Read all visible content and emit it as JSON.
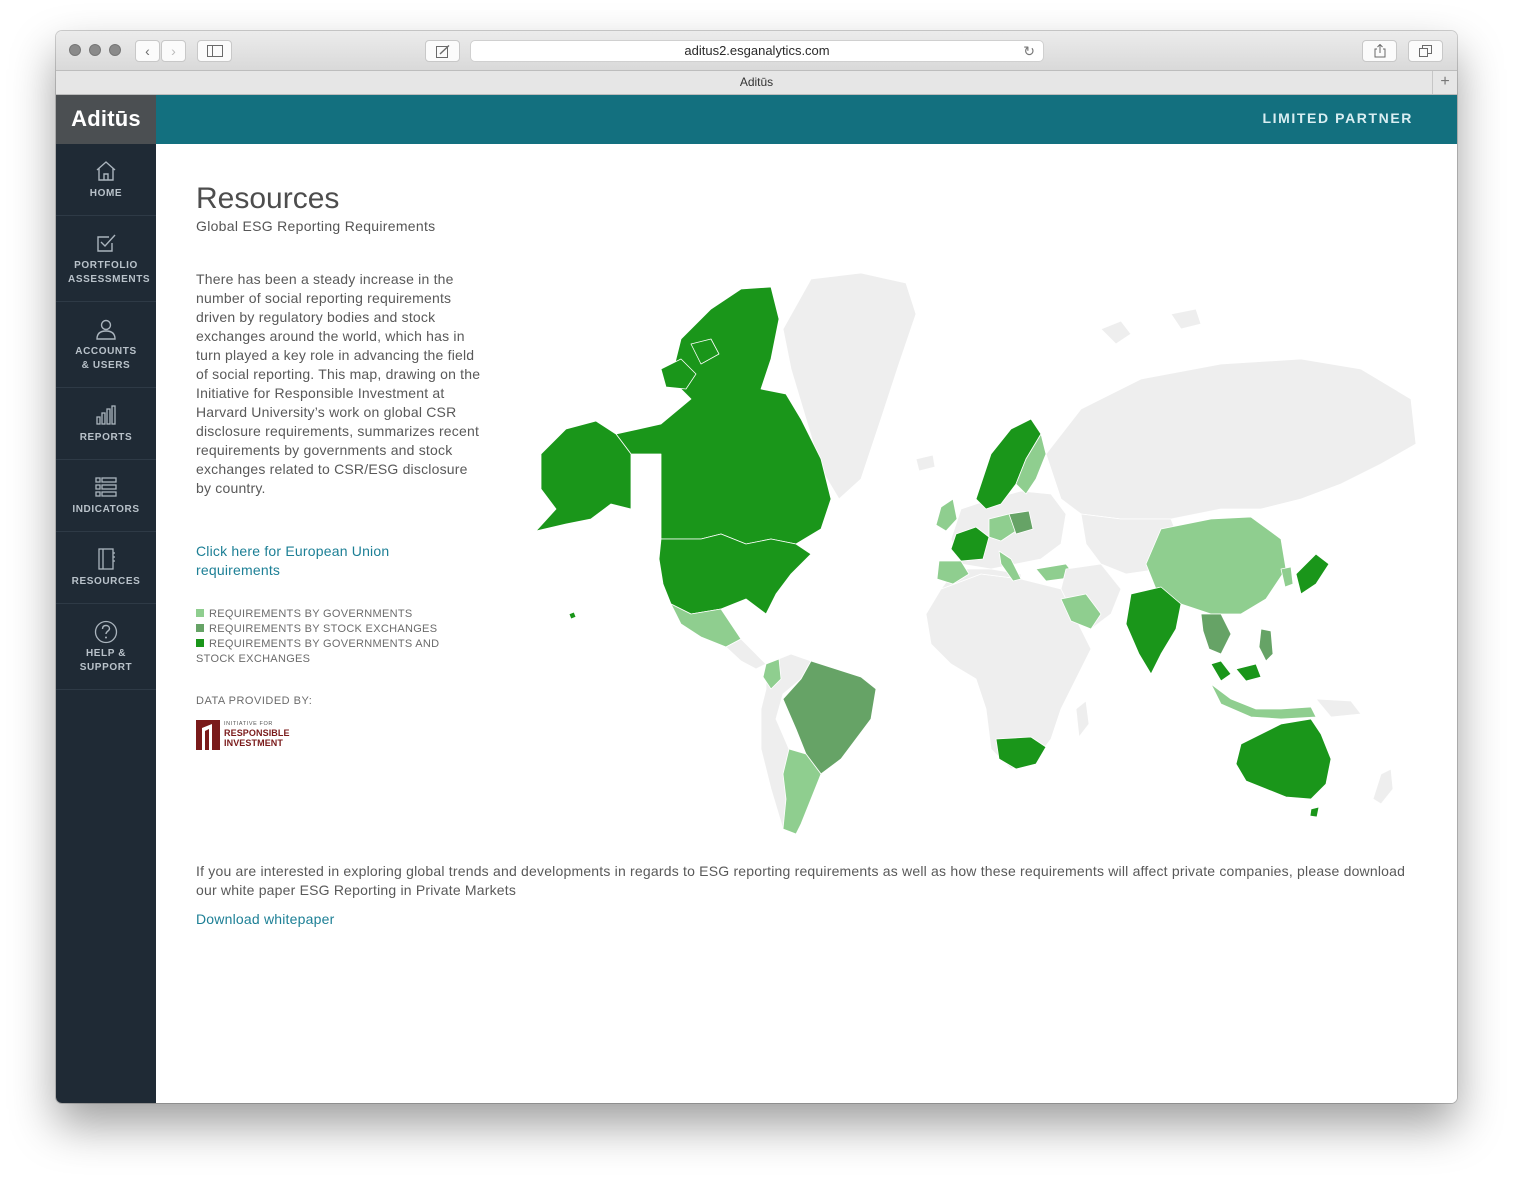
{
  "browser": {
    "url": "aditus2.esganalytics.com",
    "tab_title": "Aditūs"
  },
  "app": {
    "logo": "Aditūs",
    "role": "LIMITED PARTNER"
  },
  "sidebar": {
    "items": [
      {
        "label": "HOME",
        "icon": "home-icon"
      },
      {
        "label": "PORTFOLIO ASSESSMENTS",
        "icon": "checkbox-icon"
      },
      {
        "label": "ACCOUNTS & USERS",
        "icon": "user-icon"
      },
      {
        "label": "REPORTS",
        "icon": "bar-chart-icon"
      },
      {
        "label": "INDICATORS",
        "icon": "list-icon"
      },
      {
        "label": "RESOURCES",
        "icon": "notebook-icon"
      },
      {
        "label": "HELP & SUPPORT",
        "icon": "question-icon"
      }
    ]
  },
  "page": {
    "title": "Resources",
    "subtitle": "Global ESG Reporting Requirements",
    "intro": "There has been a steady increase in the number of social reporting requirements driven by regulatory bodies and stock exchanges around the world, which has in turn played a key role in advancing the field of social reporting. This map, drawing on the Initiative for Responsible Investment at Harvard University’s work on global CSR disclosure requirements, summarizes recent requirements by governments and stock exchanges related to CSR/ESG disclosure by country.",
    "eu_link": "Click here for European Union requirements",
    "legend": [
      {
        "label": "REQUIREMENTS BY GOVERNMENTS",
        "color": "#8fce8f"
      },
      {
        "label": "REQUIREMENTS BY STOCK EXCHANGES",
        "color": "#66a366"
      },
      {
        "label": "REQUIREMENTS BY GOVERNMENTS AND STOCK EXCHANGES",
        "color": "#1a961a"
      }
    ],
    "data_provided_by": "DATA PROVIDED BY:",
    "provider_logo": {
      "line1": "INITIATIVE FOR",
      "line2": "RESPONSIBLE",
      "line3": "INVESTMENT"
    },
    "bottom_text": "If you are interested in exploring global trends and developments in regards to ESG reporting requirements as well as how these requirements will affect private companies, please download our white paper ESG Reporting in Private Markets",
    "download_link": "Download whitepaper"
  },
  "colors": {
    "teal": "#13707f",
    "sidebar": "#1f2a35",
    "no_data": "#eeeeee",
    "governments": "#8fce8f",
    "stock_exchanges": "#66a366",
    "both": "#1a961a"
  }
}
